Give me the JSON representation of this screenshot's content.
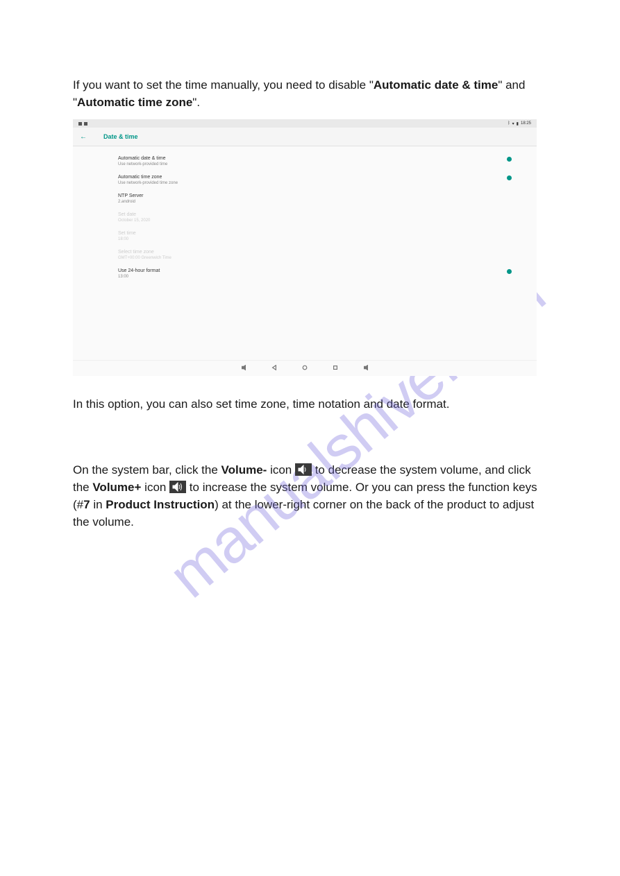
{
  "watermark": "manualshive.com",
  "intro": {
    "seg1": "If you want to set the time manually, you need to disable \"",
    "bold1": "Automatic date & time",
    "seg2": "\" and \"",
    "bold2": "Automatic time zone",
    "seg3": "\"."
  },
  "screenshot": {
    "status_time": "18:25",
    "header_title": "Date & time",
    "rows": [
      {
        "title": "Automatic date & time",
        "sub": "Use network-provided time",
        "toggle": true,
        "disabled": false
      },
      {
        "title": "Automatic time zone",
        "sub": "Use network-provided time zone",
        "toggle": true,
        "disabled": false
      },
      {
        "title": "NTP Server",
        "sub": "2.android",
        "toggle": false,
        "disabled": false
      },
      {
        "title": "Set date",
        "sub": "October 15, 2020",
        "toggle": false,
        "disabled": true
      },
      {
        "title": "Set time",
        "sub": "18:00",
        "toggle": false,
        "disabled": true
      },
      {
        "title": "Select time zone",
        "sub": "GMT+00:00 Greenwich Time",
        "toggle": false,
        "disabled": true
      },
      {
        "title": "Use 24-hour format",
        "sub": "13:00",
        "toggle": true,
        "disabled": false
      }
    ]
  },
  "followup": "In this option, you can also set time zone, time notation and date format.",
  "volume": {
    "p1_a": "On the system bar, click the ",
    "p1_b_bold": "Volume-",
    "p1_c": " icon ",
    "p1_d": " to decrease the system volume, and click the ",
    "p2_a_bold": "Volume+",
    "p2_b": " icon ",
    "p2_c": " to increase the system volume. Or you can press the function keys (#",
    "p2_d_bold": "7",
    "p2_e": " in ",
    "p3_a_bold": "Product Instruction",
    "p3_b": ") at the lower-right corner on the back of the product to adjust the volume."
  }
}
